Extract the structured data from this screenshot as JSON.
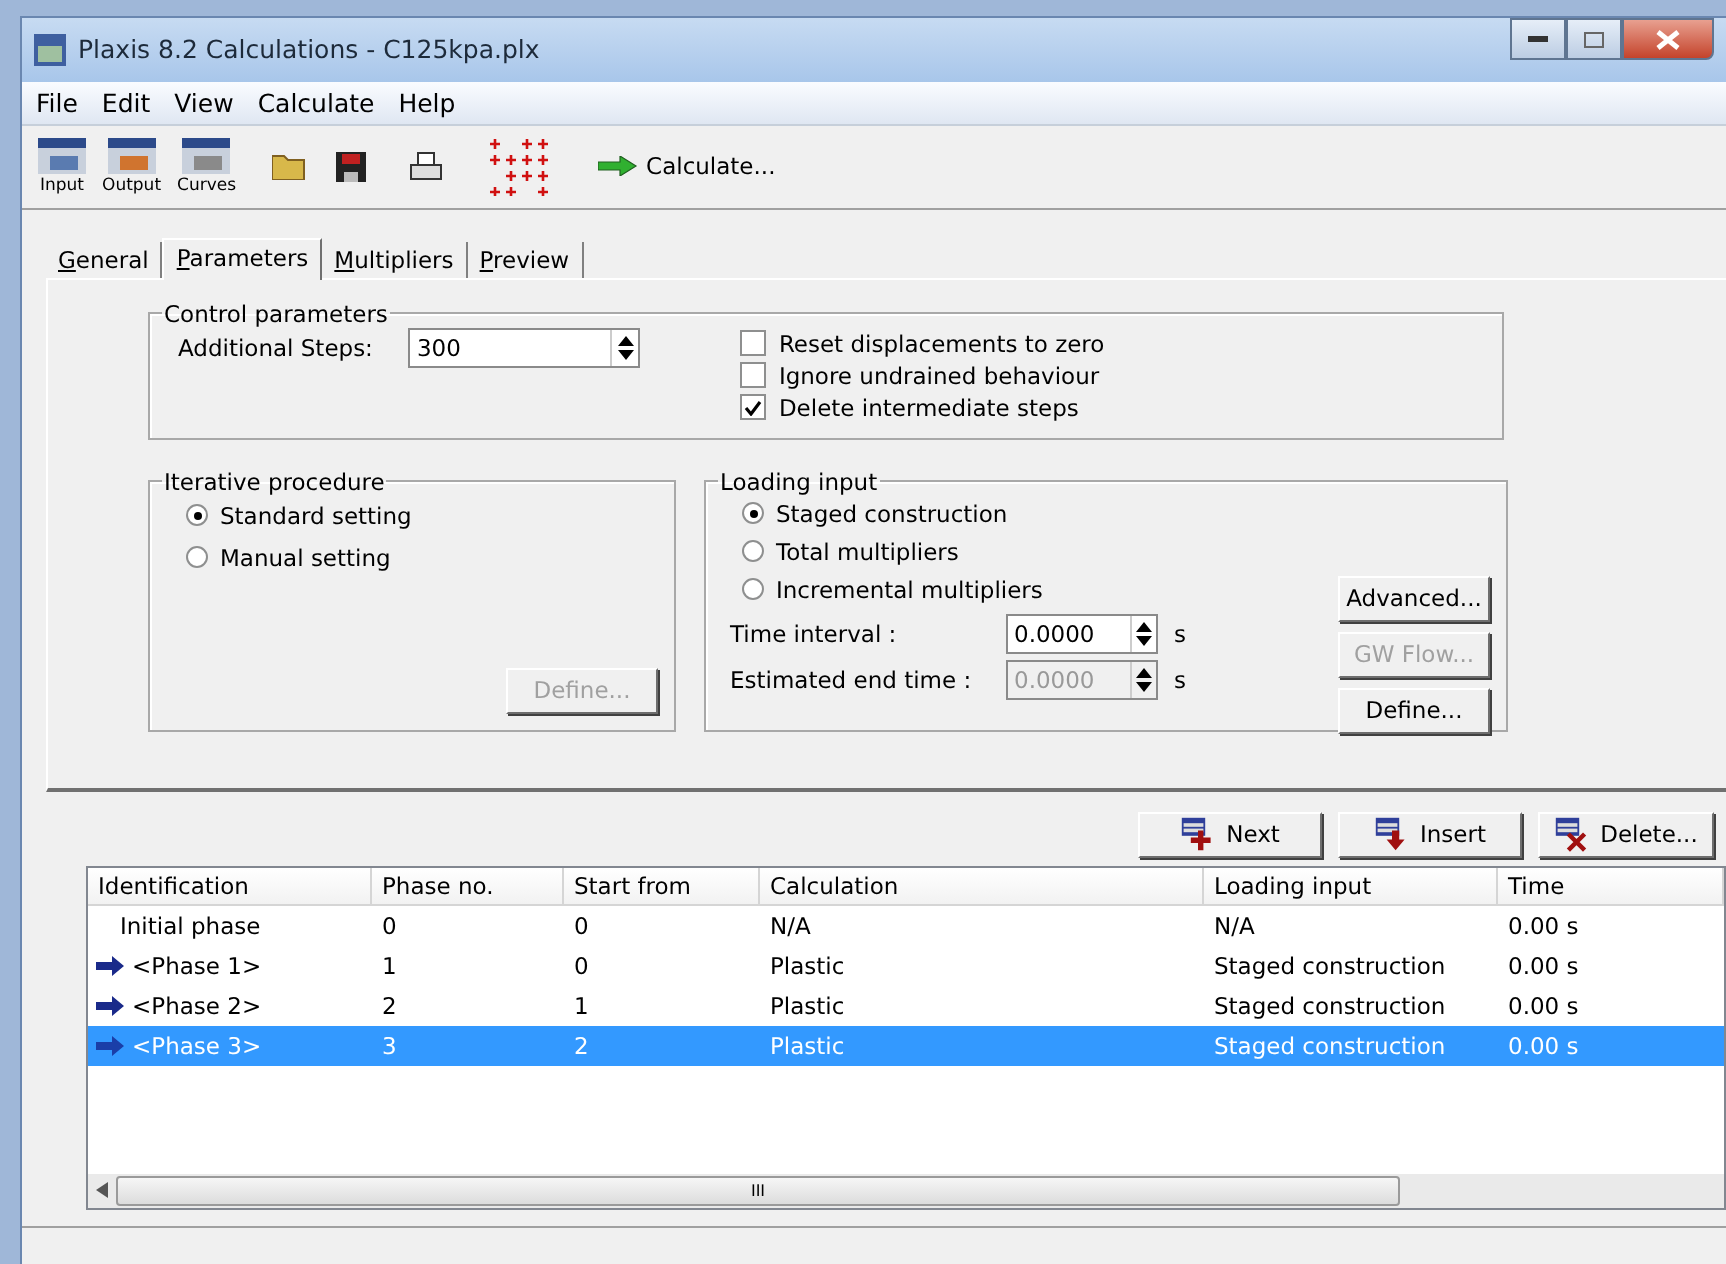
{
  "window": {
    "title": "Plaxis 8.2 Calculations - C125kpa.plx"
  },
  "menu": [
    "File",
    "Edit",
    "View",
    "Calculate",
    "Help"
  ],
  "toolbar": {
    "programs": [
      {
        "label": "Input",
        "kind": "input"
      },
      {
        "label": "Output",
        "kind": "output"
      },
      {
        "label": "Curves",
        "kind": "curves"
      }
    ],
    "calculate": "Calculate..."
  },
  "tabs": [
    {
      "label": "General",
      "selected": false
    },
    {
      "label": "Parameters",
      "selected": true
    },
    {
      "label": "Multipliers",
      "selected": false
    },
    {
      "label": "Preview",
      "selected": false
    }
  ],
  "control_parameters": {
    "title": "Control parameters",
    "steps_label": "Additional Steps:",
    "steps_value": "300",
    "options": [
      {
        "label": "Reset displacements to zero",
        "checked": false
      },
      {
        "label": "Ignore undrained behaviour",
        "checked": false
      },
      {
        "label": "Delete intermediate steps",
        "checked": true
      }
    ]
  },
  "iterative_procedure": {
    "title": "Iterative procedure",
    "options": [
      {
        "label": "Standard setting",
        "selected": true
      },
      {
        "label": "Manual setting",
        "selected": false
      }
    ],
    "define": {
      "label": "Define...",
      "disabled": true
    }
  },
  "loading_input": {
    "title": "Loading input",
    "options": [
      {
        "label": "Staged construction",
        "selected": true
      },
      {
        "label": "Total multipliers",
        "selected": false
      },
      {
        "label": "Incremental multipliers",
        "selected": false
      }
    ],
    "fields": [
      {
        "label": "Time interval :",
        "value": "0.0000",
        "unit": "s",
        "disabled": false
      },
      {
        "label": "Estimated end time :",
        "value": "0.0000",
        "unit": "s",
        "disabled": true
      }
    ],
    "buttons": [
      {
        "label": "Advanced...",
        "disabled": false
      },
      {
        "label": "GW Flow...",
        "disabled": true
      },
      {
        "label": "Define...",
        "disabled": false
      }
    ]
  },
  "phase_buttons": [
    {
      "label": "Next",
      "kind": "next"
    },
    {
      "label": "Insert",
      "kind": "insert"
    },
    {
      "label": "Delete...",
      "kind": "delete"
    }
  ],
  "table": {
    "columns": [
      "Identification",
      "Phase no.",
      "Start from",
      "Calculation",
      "Loading input",
      "Time"
    ],
    "rows": [
      {
        "cells": [
          "Initial phase",
          "0",
          "0",
          "N/A",
          "N/A",
          "0.00 s"
        ],
        "queued": false,
        "selected": false
      },
      {
        "cells": [
          "<Phase 1>",
          "1",
          "0",
          "Plastic",
          "Staged construction",
          "0.00 s"
        ],
        "queued": true,
        "selected": false
      },
      {
        "cells": [
          "<Phase 2>",
          "2",
          "1",
          "Plastic",
          "Staged construction",
          "0.00 s"
        ],
        "queued": true,
        "selected": false
      },
      {
        "cells": [
          "<Phase 3>",
          "3",
          "2",
          "Plastic",
          "Staged construction",
          "0.00 s"
        ],
        "queued": true,
        "selected": true
      }
    ],
    "scroll_mark": "III"
  }
}
